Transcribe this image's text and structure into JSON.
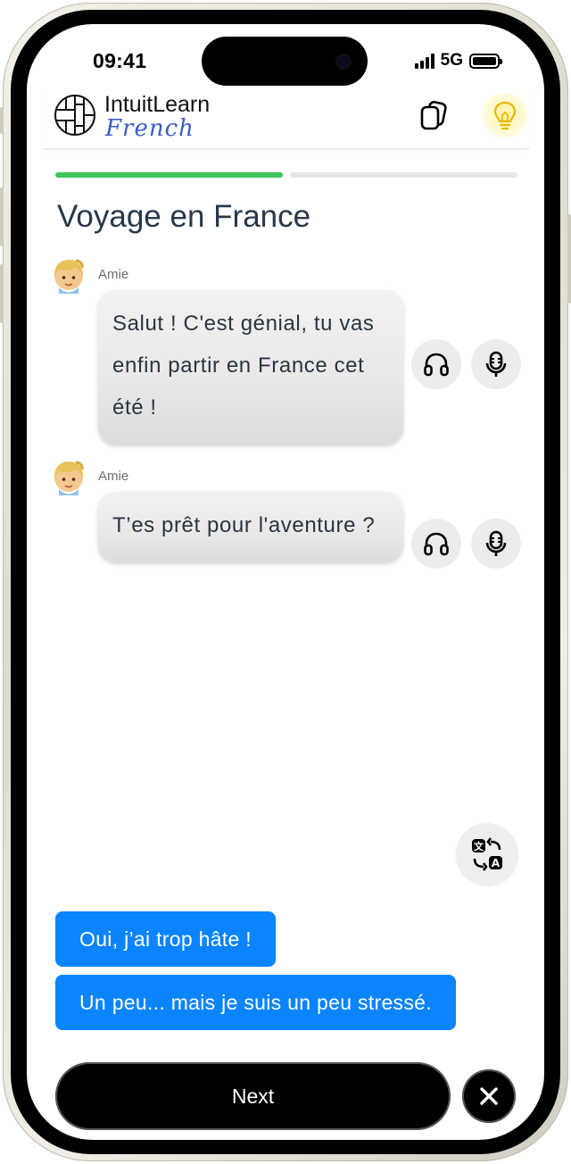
{
  "status_bar": {
    "time": "09:41",
    "network": "5G",
    "battery_level": 1.0
  },
  "header": {
    "brand_name": "IntuitLearn",
    "brand_language": "French",
    "icons": [
      "logo-grid-icon",
      "cards-icon",
      "lightbulb-icon"
    ],
    "hint_glow_color": "#fff6a8"
  },
  "progress": {
    "completed_segments": 1,
    "total_segments": 2,
    "done_color": "#3ec25a"
  },
  "lesson": {
    "title": "Voyage en France"
  },
  "messages": [
    {
      "speaker": "Amie",
      "text": "Salut ! C'est génial, tu vas enfin partir en France cet été !",
      "icons": [
        "headphones-icon",
        "microphone-icon"
      ]
    },
    {
      "speaker": "Amie",
      "text": "T’es prêt pour l'aventure ?",
      "icons": [
        "headphones-icon",
        "microphone-icon"
      ]
    }
  ],
  "translate": {
    "icon": "translate-icon"
  },
  "choices": [
    {
      "label": "Oui, j’ai trop hâte !"
    },
    {
      "label": "Un peu... mais je suis un peu stressé."
    }
  ],
  "footer": {
    "next_label": "Next",
    "close_icon": "close-icon"
  },
  "colors": {
    "accent": "#0a84ff",
    "progress": "#3ec25a",
    "text": "#27384a"
  }
}
